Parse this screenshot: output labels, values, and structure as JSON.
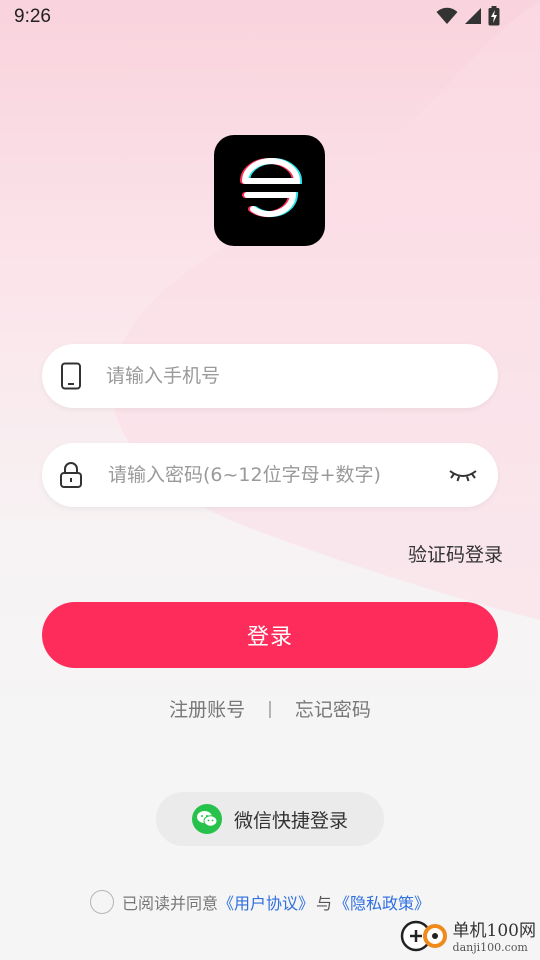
{
  "status_bar": {
    "time": "9:26",
    "icons": [
      "wifi-icon",
      "cellular-signal-icon",
      "battery-charging-icon"
    ]
  },
  "logo": {
    "icon": "app-logo-icon",
    "background": "#000000"
  },
  "login_form": {
    "phone": {
      "placeholder": "请输入手机号",
      "value": "",
      "icon": "phone-icon"
    },
    "password": {
      "placeholder": "请输入密码(6~12位字母+数字)",
      "value": "",
      "icon": "lock-icon",
      "toggle_icon": "eye-closed-icon"
    },
    "sms_login_label": "验证码登录",
    "submit_label": "登录",
    "register_label": "注册账号",
    "separator": "|",
    "forgot_label": "忘记密码"
  },
  "social_login": {
    "wechat_label": "微信快捷登录",
    "icon": "wechat-icon"
  },
  "agreement": {
    "prefix": "已阅读并同意",
    "user_agreement": "《用户协议》",
    "conjunction": "与",
    "privacy_policy": "《隐私政策》",
    "checked": false
  },
  "watermark": {
    "title": "单机100网",
    "subtitle": "danji100.com"
  },
  "colors": {
    "accent": "#fe2c5a",
    "link": "#2f6fe0",
    "wechat": "#27c24c"
  }
}
